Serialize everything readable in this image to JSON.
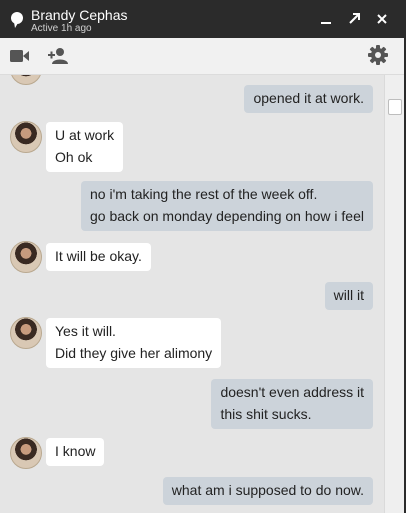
{
  "header": {
    "contact_name": "Brandy Cephas",
    "status": "Active 1h ago"
  },
  "icons": {
    "chat": "chat-bubble-icon",
    "minimize": "minimize-icon",
    "popout": "popout-icon",
    "close": "close-icon",
    "video": "video-call-icon",
    "add_person": "add-person-icon",
    "settings": "gear-icon"
  },
  "colors": {
    "titlebar": "#2b2b2b",
    "incoming_bubble": "#ffffff",
    "outgoing_bubble": "#ccd3da",
    "background": "#e5e5e5"
  },
  "messages": [
    {
      "from": "me",
      "lines": [
        "opened it at work."
      ]
    },
    {
      "from": "them",
      "lines": [
        "U at work",
        "Oh ok"
      ]
    },
    {
      "from": "me",
      "lines": [
        "no i'm taking the rest of the week off.",
        "go back on monday depending on how i feel"
      ]
    },
    {
      "from": "them",
      "lines": [
        "It will be okay."
      ]
    },
    {
      "from": "me",
      "lines": [
        "will it"
      ]
    },
    {
      "from": "them",
      "lines": [
        "Yes it will.",
        "Did they give her alimony"
      ]
    },
    {
      "from": "me",
      "lines": [
        "doesn't even address it",
        "this shit sucks."
      ]
    },
    {
      "from": "them",
      "lines": [
        "I know"
      ]
    },
    {
      "from": "me",
      "lines": [
        "what am i supposed to do now."
      ]
    }
  ]
}
